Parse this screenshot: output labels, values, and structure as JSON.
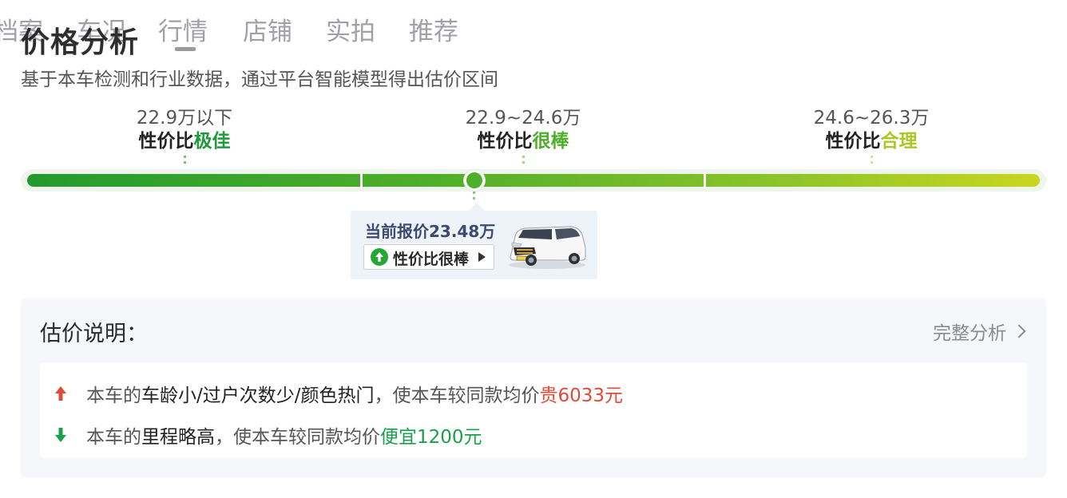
{
  "tabs": [
    {
      "label": "档案"
    },
    {
      "label": "车况"
    },
    {
      "label": "行情"
    },
    {
      "label": "店铺"
    },
    {
      "label": "实拍"
    },
    {
      "label": "推荐"
    }
  ],
  "header": {
    "title": "价格分析",
    "subtitle": "基于本车检测和行业数据，通过平台智能模型得出估价区间"
  },
  "segments": [
    {
      "range": "22.9万以下",
      "prefix": "性价比",
      "verdict": "极佳",
      "color": "#1f9a3a"
    },
    {
      "range": "22.9~24.6万",
      "prefix": "性价比",
      "verdict": "很棒",
      "color": "#4fae2a"
    },
    {
      "range": "24.6~26.3万",
      "prefix": "性价比",
      "verdict": "合理",
      "color": "#a9c826"
    }
  ],
  "current": {
    "price_text": "当前报价23.48万",
    "price_wan": 23.48,
    "verdict_label": "性价比很棒",
    "verdict_icon": "arrow-up-circle-icon",
    "car_image": "white-mpv-car-image"
  },
  "explain": {
    "title": "估价说明：",
    "link_label": "完整分析",
    "reasons": [
      {
        "direction": "up",
        "icon": "red-arrow-up-icon",
        "prefix": "本车的",
        "factors": "车龄小/过户次数少/颜色热门",
        "middle": "，使本车较同款均价",
        "effect": "贵6033元",
        "color": "#e04a3a"
      },
      {
        "direction": "down",
        "icon": "green-arrow-down-icon",
        "prefix": "本车的",
        "factors": "里程略高",
        "middle": "，使本车较同款均价",
        "effect": "便宜1200元",
        "color": "#1aa04a"
      }
    ]
  }
}
